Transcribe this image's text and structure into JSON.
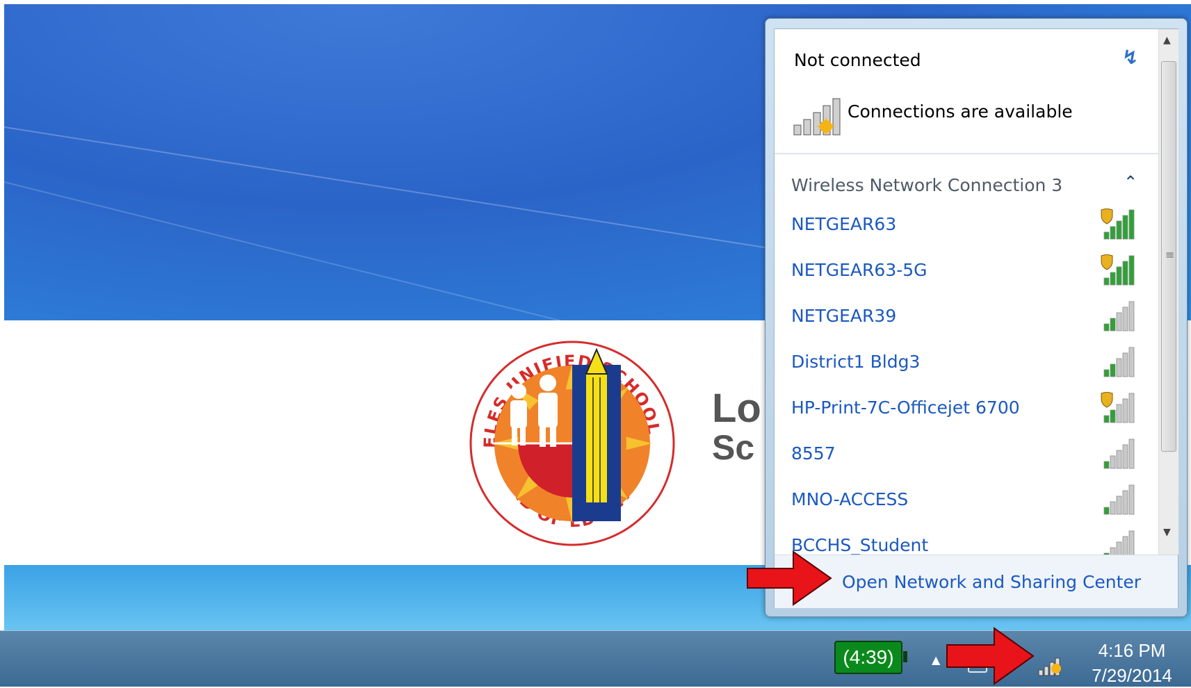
{
  "popup": {
    "status_title": "Not connected",
    "status_detail": "Connections are available",
    "section_title": "Wireless Network Connection 3",
    "networks": [
      {
        "name": "NETGEAR63",
        "secured": true,
        "signal_bars": 5
      },
      {
        "name": "NETGEAR63-5G",
        "secured": true,
        "signal_bars": 5
      },
      {
        "name": "NETGEAR39",
        "secured": false,
        "signal_bars": 2
      },
      {
        "name": "District1 Bldg3",
        "secured": false,
        "signal_bars": 2
      },
      {
        "name": "HP-Print-7C-Officejet 6700",
        "secured": true,
        "signal_bars": 2
      },
      {
        "name": "8557",
        "secured": false,
        "signal_bars": 1
      },
      {
        "name": "MNO-ACCESS",
        "secured": false,
        "signal_bars": 1
      },
      {
        "name": "BCCHS_Student",
        "secured": false,
        "signal_bars": 1
      }
    ],
    "footer_link": "Open Network and Sharing Center"
  },
  "desktop": {
    "seal_text_top": "LOS ANGELES UNIFIED SCHOOL DISTRICT",
    "seal_text_bottom": "BOARD OF EDUCATION",
    "brand_line1": "Lo",
    "brand_line2": "Sc"
  },
  "taskbar": {
    "battery_label": "(4:39)",
    "time": "4:16 PM",
    "date": "7/29/2014"
  },
  "colors": {
    "link": "#1b58c0",
    "annotation_arrow": "#e8141a",
    "signal_active": "#2fa236",
    "signal_inactive": "#c9c9c9"
  }
}
